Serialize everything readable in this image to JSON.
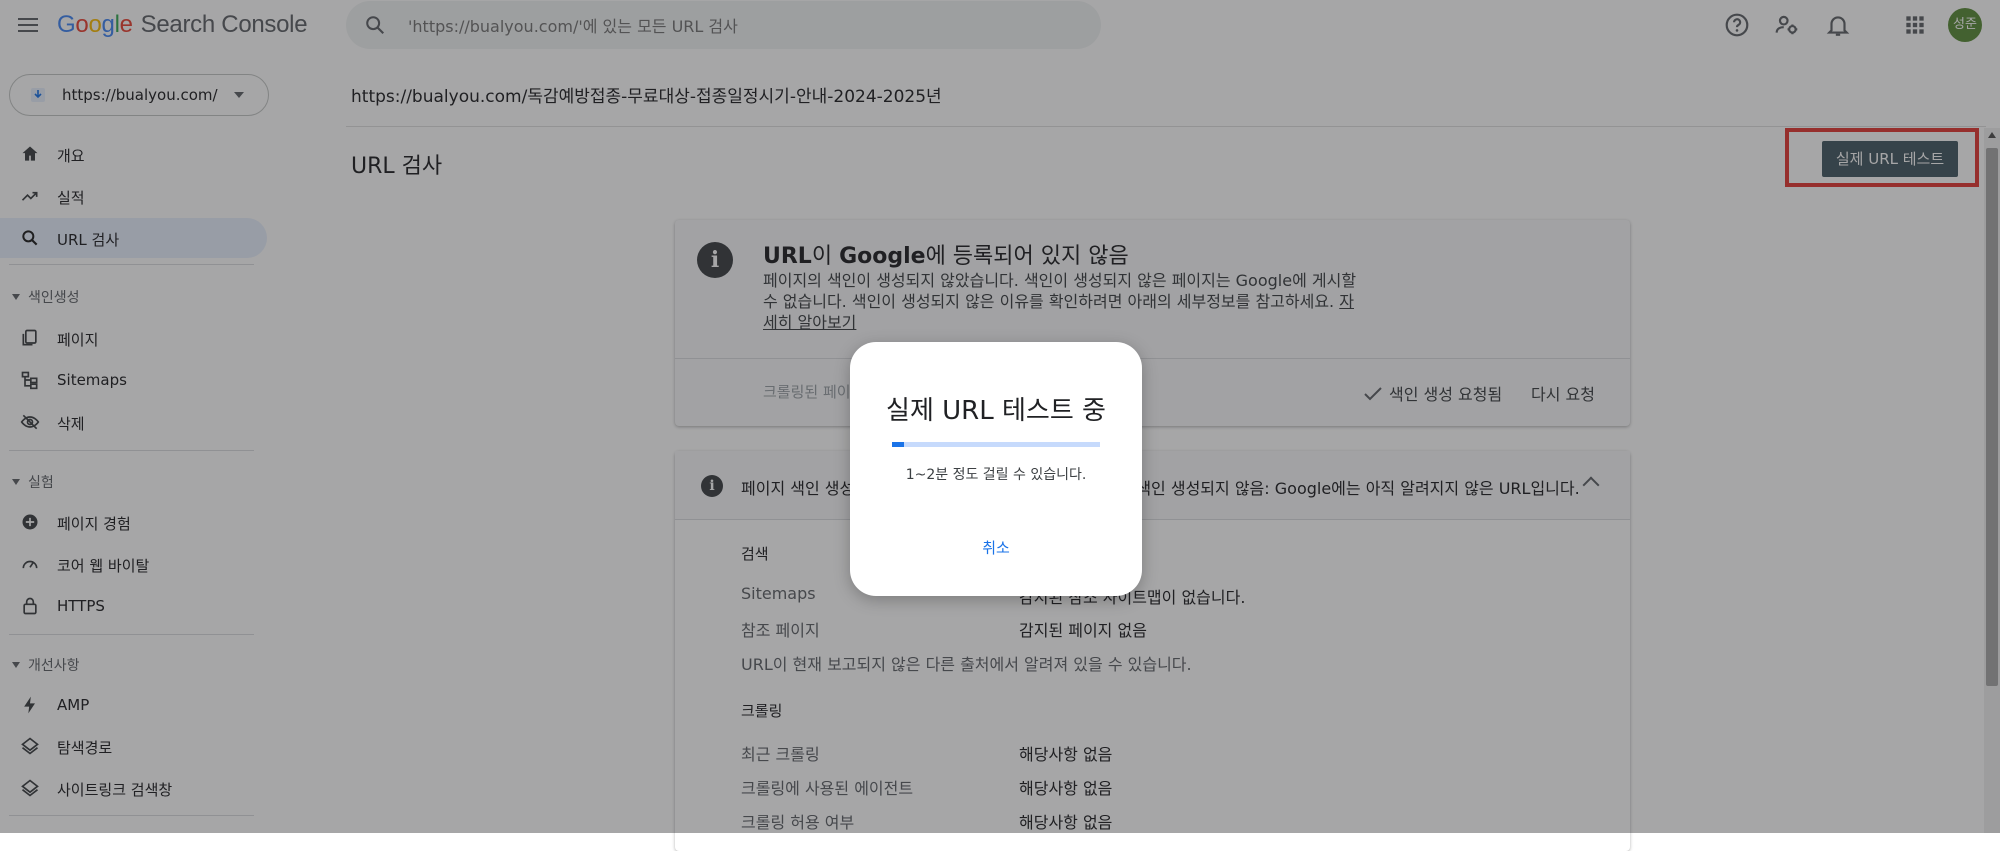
{
  "topbar": {
    "logo_letters": [
      "G",
      "o",
      "o",
      "g",
      "l",
      "e"
    ],
    "product": "Search Console",
    "search_placeholder": "'https://bualyou.com/'에 있는 모든 URL 검사",
    "avatar_text": "성준",
    "icons": [
      "help-icon",
      "manage-users-icon",
      "notifications-icon",
      "apps-icon"
    ]
  },
  "sidebar": {
    "property": "https://bualyou.com/",
    "items_top": [
      {
        "label": "개요",
        "icon": "home-icon"
      },
      {
        "label": "실적",
        "icon": "trending-up-icon"
      },
      {
        "label": "URL 검사",
        "icon": "search-icon",
        "active": true
      }
    ],
    "section_index": "색인생성",
    "items_index": [
      {
        "label": "페이지",
        "icon": "pages-icon"
      },
      {
        "label": "Sitemaps",
        "icon": "sitemap-icon"
      },
      {
        "label": "삭제",
        "icon": "visibility-off-icon"
      }
    ],
    "section_exp": "실험",
    "items_exp": [
      {
        "label": "페이지 경험",
        "icon": "add-circle-icon"
      },
      {
        "label": "코어 웹 바이탈",
        "icon": "speed-icon"
      },
      {
        "label": "HTTPS",
        "icon": "lock-icon"
      }
    ],
    "section_improve": "개선사항",
    "items_improve": [
      {
        "label": "AMP",
        "icon": "bolt-icon"
      },
      {
        "label": "탐색경로",
        "icon": "layers-icon"
      },
      {
        "label": "사이트링크 검색창",
        "icon": "layers-icon"
      }
    ]
  },
  "main": {
    "inspected_url": "https://bualyou.com/독감예방접종-무료대상-접종일정시기-안내-2024-2025년",
    "title": "URL 검사",
    "live_test_button": "실제 URL 테스트",
    "status_card": {
      "title_part1": "URL",
      "title_part2": "이 ",
      "title_part3": "Google",
      "title_part4": "에 등록되어 있지 않음",
      "desc": "페이지의 색인이 생성되지 않았습니다. 색인이 생성되지 않은 페이지는 Google에 게시할 수 없습니다. 색인이 생성되지 않은 이유를 확인하려면 아래의 세부정보를 참고하세요.",
      "learn_more": "자세히 알아보기",
      "crawled_label": "크롤링된 페이지 보기",
      "requested_label": "색인 생성 요청됨",
      "request_again": "다시 요청"
    },
    "detail_card": {
      "heading": "페이지 색인 생성: URL이 Google에 등록되어 있지 않음 - 색인 생성되지 않음: Google에는 아직 알려지지 않은 URL입니다.",
      "section_discovery": "검색",
      "sitemaps_key": "Sitemaps",
      "sitemaps_val": "감지된 참조 사이트맵이 없습니다.",
      "referring_key": "참조 페이지",
      "referring_val": "감지된 페이지 없음",
      "discovery_note": "URL이 현재 보고되지 않은 다른 출처에서 알려져 있을 수 있습니다.",
      "section_crawl": "크롤링",
      "last_crawl_key": "최근 크롤링",
      "last_crawl_val": "해당사항 없음",
      "agent_key": "크롤링에 사용된 에이전트",
      "agent_val": "해당사항 없음",
      "allowed_key": "크롤링 허용 여부",
      "allowed_val": "해당사항 없음"
    }
  },
  "dialog": {
    "title": "실제 URL 테스트 중",
    "subtitle": "1~2분 정도 걸릴 수 있습니다.",
    "progress_percent": 6,
    "cancel": "취소"
  },
  "colors": {
    "accent": "#1a73e8",
    "live_button": "#455a64",
    "highlight_box": "#e53935"
  }
}
